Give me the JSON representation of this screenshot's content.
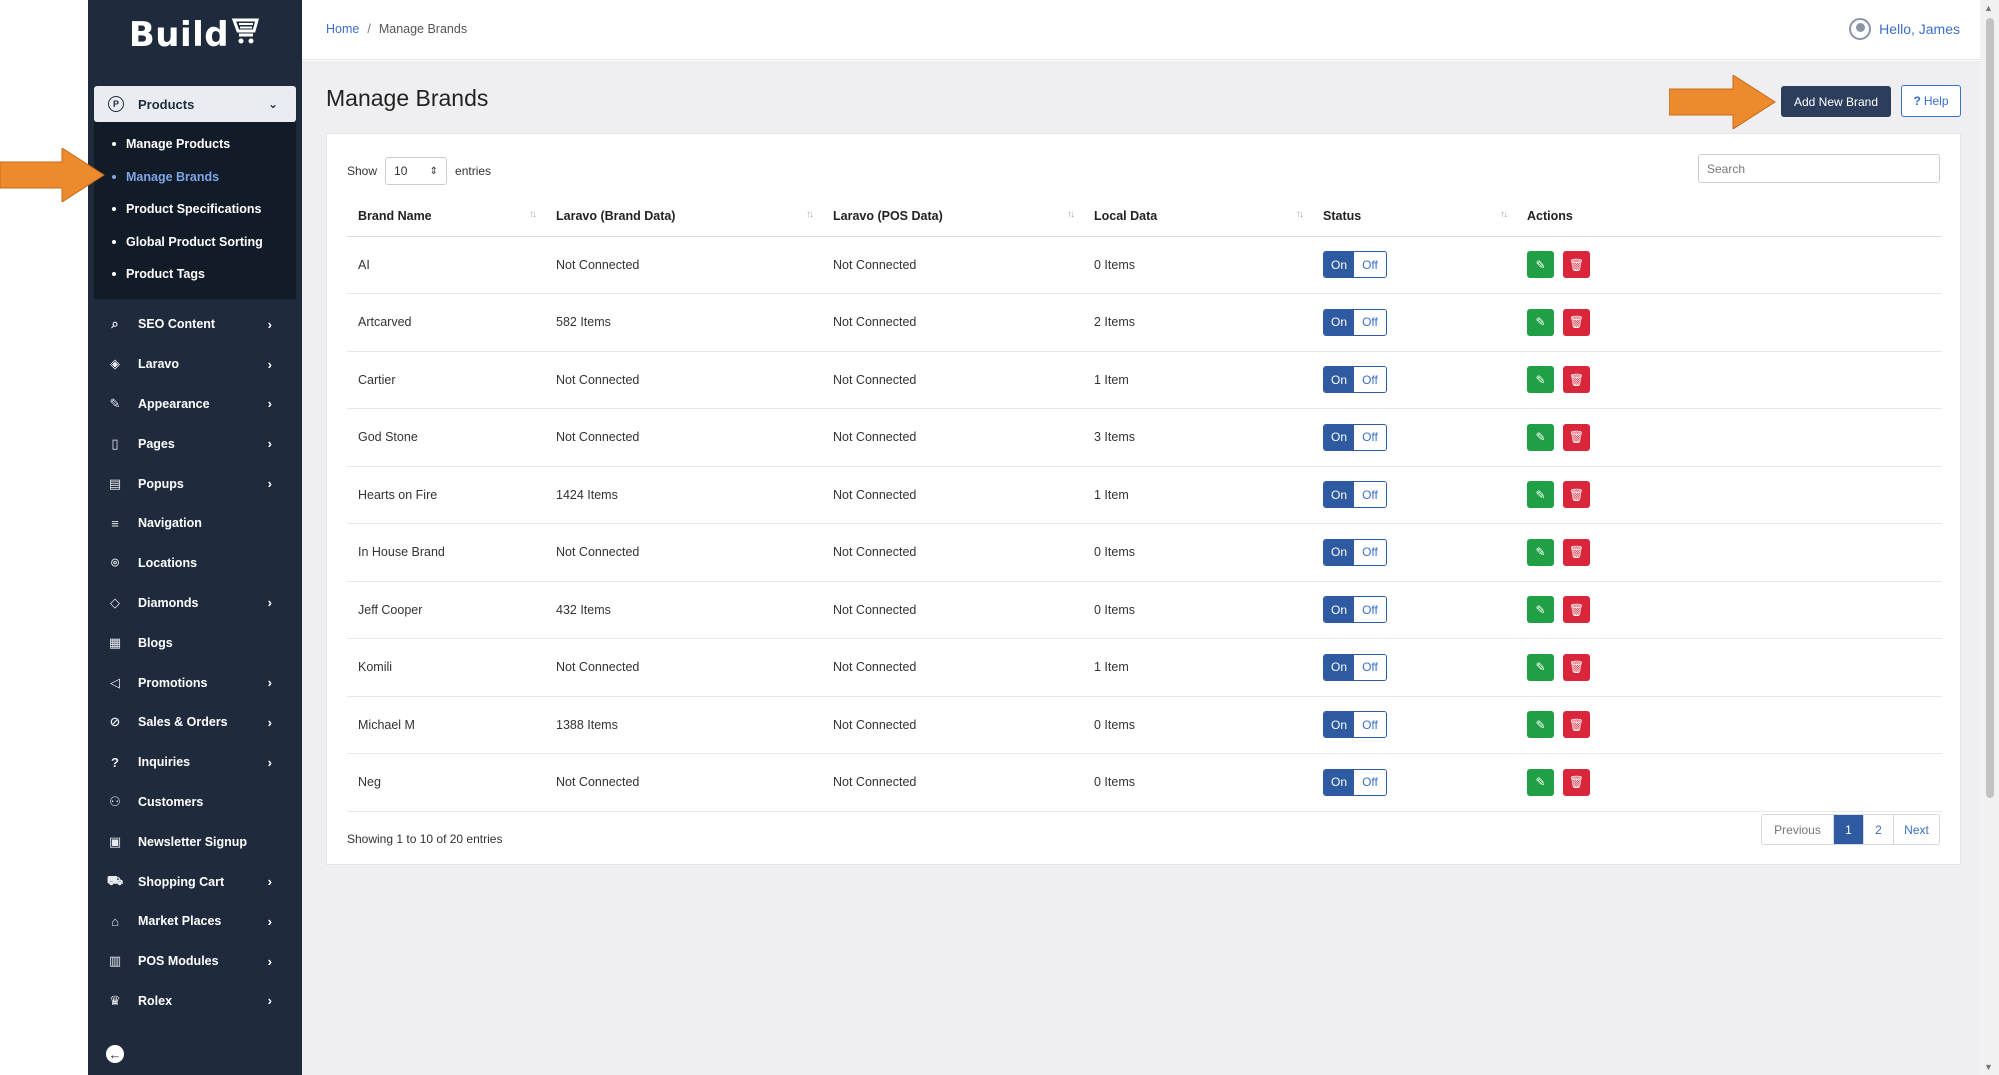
{
  "app": {
    "logo": "Build"
  },
  "sidebar": {
    "products": {
      "label": "Products",
      "icon": "P"
    },
    "sub_items": [
      {
        "label": "Manage Products",
        "active": false
      },
      {
        "label": "Manage Brands",
        "active": true
      },
      {
        "label": "Product Specifications",
        "active": false
      },
      {
        "label": "Global Product Sorting",
        "active": false
      },
      {
        "label": "Product Tags",
        "active": false
      }
    ],
    "items": [
      {
        "label": "SEO Content",
        "icon": "seo-icon",
        "has_arrow": true
      },
      {
        "label": "Laravo",
        "icon": "laravo-icon",
        "has_arrow": true
      },
      {
        "label": "Appearance",
        "icon": "brush-icon",
        "has_arrow": true
      },
      {
        "label": "Pages",
        "icon": "page-icon",
        "has_arrow": true
      },
      {
        "label": "Popups",
        "icon": "popup-icon",
        "has_arrow": true
      },
      {
        "label": "Navigation",
        "icon": "menu-icon",
        "has_arrow": false
      },
      {
        "label": "Locations",
        "icon": "pin-icon",
        "has_arrow": false
      },
      {
        "label": "Diamonds",
        "icon": "diamond-icon",
        "has_arrow": true
      },
      {
        "label": "Blogs",
        "icon": "blog-icon",
        "has_arrow": false
      },
      {
        "label": "Promotions",
        "icon": "megaphone-icon",
        "has_arrow": true
      },
      {
        "label": "Sales & Orders",
        "icon": "sales-icon",
        "has_arrow": true
      },
      {
        "label": "Inquiries",
        "icon": "question-icon",
        "has_arrow": true
      },
      {
        "label": "Customers",
        "icon": "user-icon",
        "has_arrow": false
      },
      {
        "label": "Newsletter Signup",
        "icon": "newsletter-icon",
        "has_arrow": false
      },
      {
        "label": "Shopping Cart",
        "icon": "cart-icon",
        "has_arrow": true
      },
      {
        "label": "Market Places",
        "icon": "store-icon",
        "has_arrow": true
      },
      {
        "label": "POS Modules",
        "icon": "pos-icon",
        "has_arrow": true
      },
      {
        "label": "Rolex",
        "icon": "crown-icon",
        "has_arrow": true
      }
    ]
  },
  "header": {
    "breadcrumb_home": "Home",
    "breadcrumb_sep": "/",
    "breadcrumb_current": "Manage Brands",
    "user_greeting": "Hello, James"
  },
  "main": {
    "title": "Manage Brands",
    "add_button": "Add New Brand",
    "help_button": "Help",
    "show_label": "Show",
    "entries_value": "10",
    "entries_label": "entries",
    "search_placeholder": "Search",
    "columns": [
      "Brand Name",
      "Laravo (Brand Data)",
      "Laravo (POS Data)",
      "Local Data",
      "Status",
      "Actions"
    ],
    "rows": [
      {
        "brand": "AI",
        "brand_data": "Not Connected",
        "pos_data": "Not Connected",
        "local": "0 Items"
      },
      {
        "brand": "Artcarved",
        "brand_data": "582 Items",
        "pos_data": "Not Connected",
        "local": "2 Items"
      },
      {
        "brand": "Cartier",
        "brand_data": "Not Connected",
        "pos_data": "Not Connected",
        "local": "1 Item"
      },
      {
        "brand": "God Stone",
        "brand_data": "Not Connected",
        "pos_data": "Not Connected",
        "local": "3 Items"
      },
      {
        "brand": "Hearts on Fire",
        "brand_data": "1424 Items",
        "pos_data": "Not Connected",
        "local": "1 Item"
      },
      {
        "brand": "In House Brand",
        "brand_data": "Not Connected",
        "pos_data": "Not Connected",
        "local": "0 Items"
      },
      {
        "brand": "Jeff Cooper",
        "brand_data": "432 Items",
        "pos_data": "Not Connected",
        "local": "0 Items"
      },
      {
        "brand": "Komili",
        "brand_data": "Not Connected",
        "pos_data": "Not Connected",
        "local": "1 Item"
      },
      {
        "brand": "Michael M",
        "brand_data": "1388 Items",
        "pos_data": "Not Connected",
        "local": "0 Items"
      },
      {
        "brand": "Neg",
        "brand_data": "Not Connected",
        "pos_data": "Not Connected",
        "local": "0 Items"
      }
    ],
    "toggle_on": "On",
    "toggle_off": "Off",
    "footer_info": "Showing 1 to 10 of 20 entries",
    "pagination": {
      "previous": "Previous",
      "pages": [
        "1",
        "2"
      ],
      "next": "Next",
      "current": "1"
    }
  },
  "colors": {
    "sidebar": "#1f2b3d",
    "accent": "#2d5aa0",
    "annotation_arrow": "#ee8a2e",
    "edit": "#20a045",
    "delete": "#d9263a"
  }
}
